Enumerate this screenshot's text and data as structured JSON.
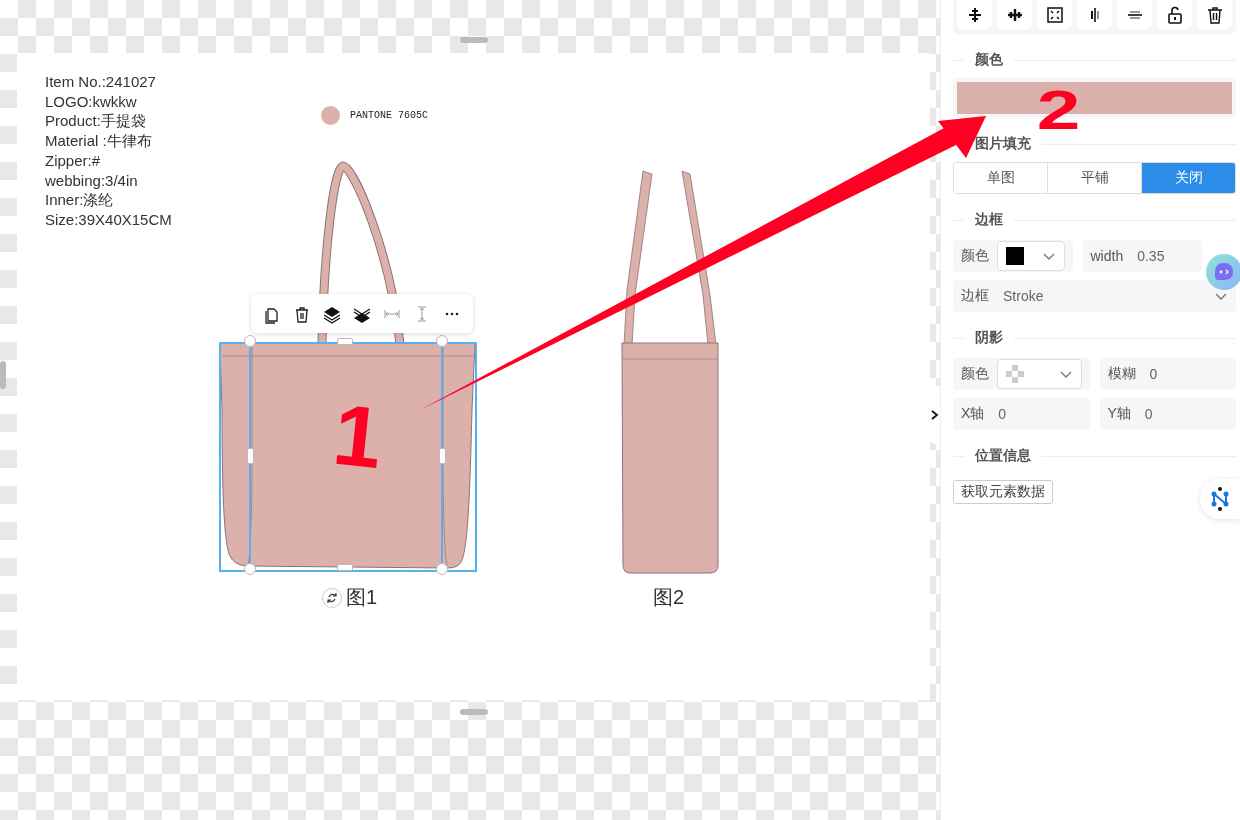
{
  "canvas": {
    "spec_lines": [
      "Item No.:241027",
      "LOGO:kwkkw",
      "Product:手提袋",
      "Material :牛律布",
      "Zipper:#",
      "webbing:3/4in",
      "Inner:涤纶",
      "Size:39X40X15CM"
    ],
    "pantone": {
      "color": "#dcb1ab",
      "label": "PANTONE 7605C"
    },
    "figures": [
      {
        "kind": "front",
        "caption": "图1",
        "selected": true
      },
      {
        "kind": "side",
        "caption": "图2",
        "selected": false
      }
    ],
    "annotations": [
      {
        "label": "1"
      },
      {
        "label": "2"
      }
    ]
  },
  "panel": {
    "color_section": {
      "title": "颜色",
      "color": "#dcb1ab"
    },
    "image_fill": {
      "title": "图片填充",
      "options": [
        {
          "label": "单图",
          "selected": false
        },
        {
          "label": "平铺",
          "selected": false
        },
        {
          "label": "关闭",
          "selected": true
        }
      ]
    },
    "border": {
      "title": "边框",
      "color_label": "颜色",
      "color": "#000000",
      "width_label": "width",
      "width_value": "0.35",
      "style_label": "边框",
      "style_value": "Stroke"
    },
    "shadow": {
      "title": "阴影",
      "color_label": "颜色",
      "blur_label": "模糊",
      "blur_value": "0",
      "x_label": "X轴",
      "x_value": "0",
      "y_label": "Y轴",
      "y_value": "0"
    },
    "position": {
      "title": "位置信息",
      "button": "获取元素数据"
    }
  }
}
